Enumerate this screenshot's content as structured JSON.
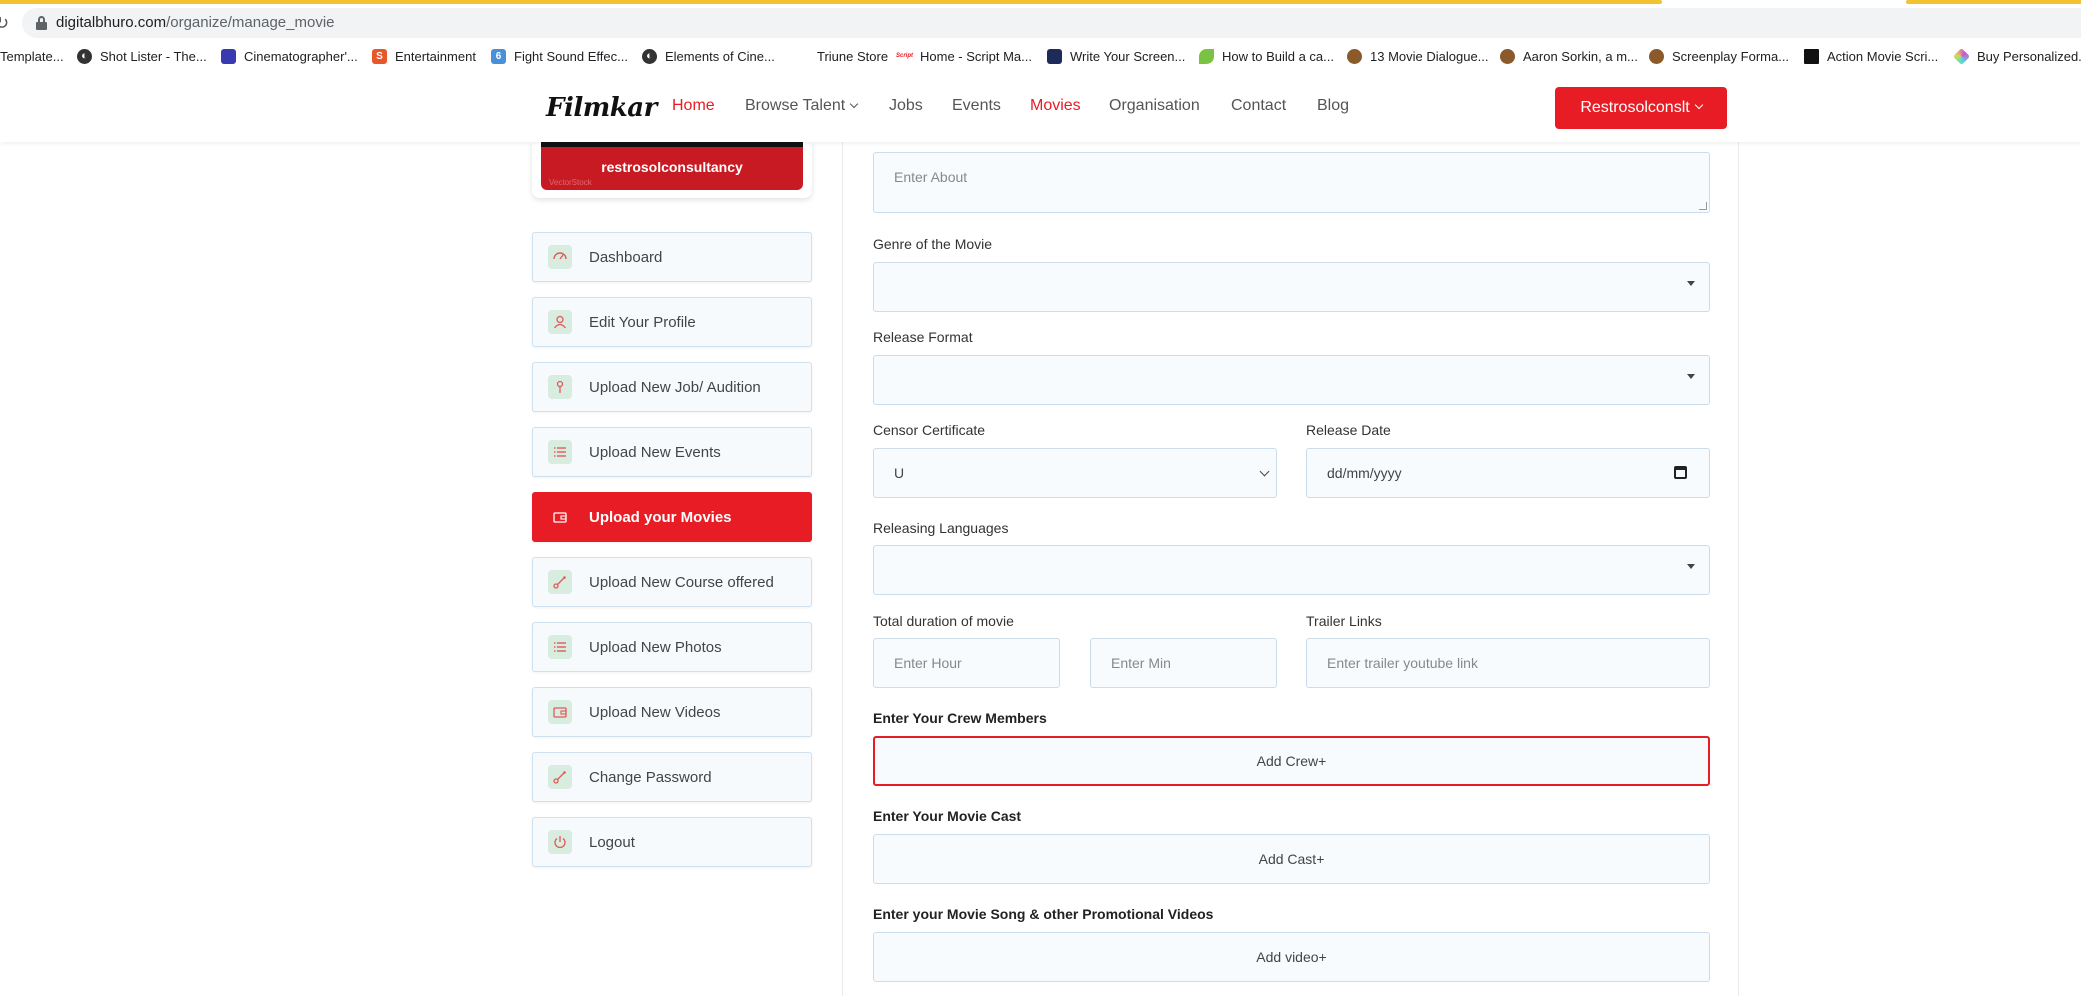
{
  "browser": {
    "url_domain": "digitalbhuro.com",
    "url_path": "/organize/manage_movie",
    "bookmarks": [
      {
        "label": "Template...",
        "icon": "page-icon",
        "color": "#777777"
      },
      {
        "label": "Shot Lister - The...",
        "icon": "globe-icon",
        "color": "#333333"
      },
      {
        "label": "Cinematographer'...",
        "icon": "film-icon",
        "color": "#3a3ab0"
      },
      {
        "label": "Entertainment",
        "icon": "s-icon",
        "color": "#e8572a"
      },
      {
        "label": "Fight Sound Effec...",
        "icon": "six-icon",
        "color": "#4a90d9"
      },
      {
        "label": "Elements of Cine...",
        "icon": "globe-icon",
        "color": "#333333"
      },
      {
        "label": "Triune Store",
        "icon": "blank-icon",
        "color": "#ffffff"
      },
      {
        "label": "Home - Script Ma...",
        "icon": "script-icon",
        "color": "#e81c24"
      },
      {
        "label": "Write Your Screen...",
        "icon": "square-icon",
        "color": "#1d2a5a"
      },
      {
        "label": "How to Build a ca...",
        "icon": "leaf-icon",
        "color": "#7bc142"
      },
      {
        "label": "13 Movie Dialogue...",
        "icon": "avatar-icon",
        "color": "#8a5a2b"
      },
      {
        "label": "Aaron Sorkin, a m...",
        "icon": "avatar-icon",
        "color": "#8a5a2b"
      },
      {
        "label": "Screenplay Forma...",
        "icon": "avatar-icon",
        "color": "#8a5a2b"
      },
      {
        "label": "Action Movie Scri...",
        "icon": "clapper-icon",
        "color": "#111111"
      },
      {
        "label": "Buy Personalized...",
        "icon": "cube-icon",
        "color": "#d94ad9"
      }
    ]
  },
  "header": {
    "logo": "Filmkar",
    "nav": [
      {
        "label": "Home",
        "active": true
      },
      {
        "label": "Browse Talent",
        "dropdown": true
      },
      {
        "label": "Jobs"
      },
      {
        "label": "Events"
      },
      {
        "label": "Movies",
        "active": true
      },
      {
        "label": "Organisation"
      },
      {
        "label": "Contact"
      },
      {
        "label": "Blog"
      }
    ],
    "user_button": "Restrosolconslt"
  },
  "sidebar": {
    "profile_name": "restrosolconsultancy",
    "profile_watermark": "VectorStock",
    "items": [
      {
        "label": "Dashboard",
        "icon": "dashboard-icon"
      },
      {
        "label": "Edit Your Profile",
        "icon": "user-icon"
      },
      {
        "label": "Upload New Job/ Audition",
        "icon": "pin-icon"
      },
      {
        "label": "Upload New Events",
        "icon": "list-icon"
      },
      {
        "label": "Upload your Movies",
        "icon": "wallet-icon",
        "active": true
      },
      {
        "label": "Upload New Course offered",
        "icon": "link-icon"
      },
      {
        "label": "Upload New Photos",
        "icon": "list-icon"
      },
      {
        "label": "Upload New Videos",
        "icon": "wallet-icon"
      },
      {
        "label": "Change Password",
        "icon": "link-icon"
      },
      {
        "label": "Logout",
        "icon": "power-icon"
      }
    ]
  },
  "form": {
    "about_placeholder": "Enter About",
    "genre_label": "Genre of the Movie",
    "release_format_label": "Release Format",
    "censor_label": "Censor Certificate",
    "censor_value": "U",
    "release_date_label": "Release Date",
    "release_date_placeholder": "dd/mm/yyyy",
    "languages_label": "Releasing Languages",
    "duration_label": "Total duration of movie",
    "hour_placeholder": "Enter Hour",
    "min_placeholder": "Enter Min",
    "trailer_label": "Trailer Links",
    "trailer_placeholder": "Enter trailer youtube link",
    "crew_label": "Enter Your Crew Members",
    "crew_button": "Add Crew+",
    "cast_label": "Enter Your Movie Cast",
    "cast_button": "Add Cast+",
    "video_label": "Enter your Movie Song & other Promotional Videos",
    "video_button": "Add video+"
  },
  "colors": {
    "accent": "#e81c24",
    "icon_bg": "#d9ece0",
    "field_border": "#cddcea"
  }
}
